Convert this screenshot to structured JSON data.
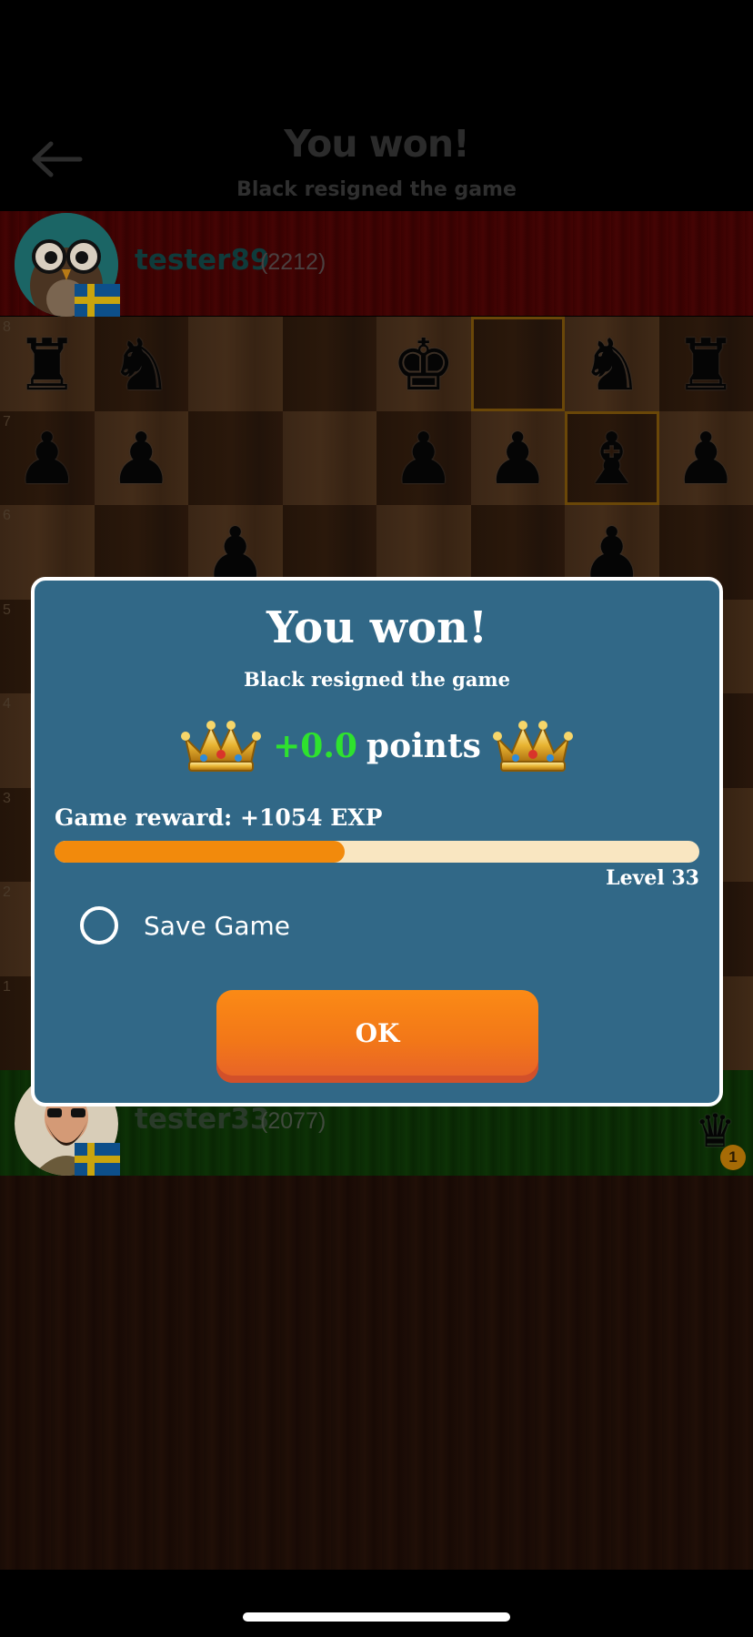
{
  "header": {
    "title": "You won!",
    "subtitle": "Black resigned the game",
    "back_icon": "arrow-left-icon"
  },
  "opponent": {
    "name": "tester89",
    "rating": "(2212)",
    "flag": "sweden-flag",
    "bar_color": "#3f0303"
  },
  "player": {
    "name": "tester33",
    "rating": "(2077)",
    "flag": "sweden-flag",
    "bar_color": "#0c2e06"
  },
  "board": {
    "rank_labels": [
      "8",
      "7",
      "6",
      "5",
      "4",
      "3",
      "2",
      "1"
    ],
    "pieces": {
      "rank8": [
        "♜",
        "♞",
        "",
        "",
        "♚",
        "",
        "♞",
        "♜"
      ],
      "rank7": [
        "♟",
        "♟",
        "",
        "",
        "♟",
        "♟",
        "♝",
        "♟"
      ],
      "rank6": [
        "",
        "",
        "♟",
        "",
        "",
        "",
        "♟",
        ""
      ]
    }
  },
  "dialog": {
    "title": "You won!",
    "subtitle": "Black resigned the game",
    "points_value": "+0.0",
    "points_label": "points",
    "reward": "Game reward: +1054 EXP",
    "xp_progress": 0.45,
    "level": "Level 33",
    "save_label": "Save Game",
    "ok_label": "OK",
    "accent_color": "#316887",
    "button_color": "#f27718"
  },
  "captured": {
    "piece": "♛",
    "count": "1"
  }
}
